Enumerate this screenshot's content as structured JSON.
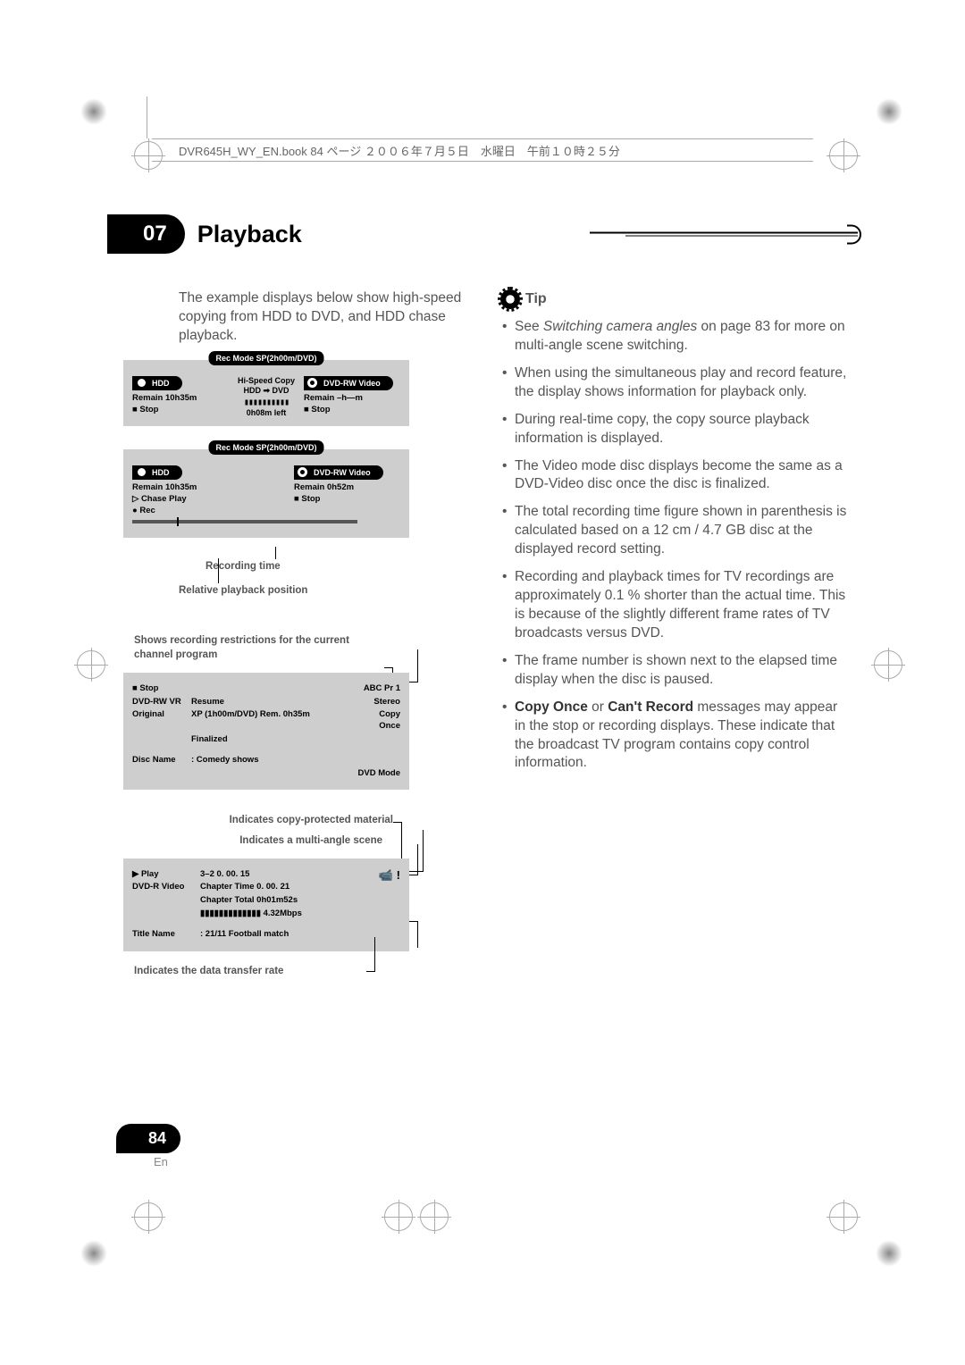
{
  "header": {
    "filename": "DVR645H_WY_EN.book  84 ページ  ２００６年７月５日　水曜日　午前１０時２５分"
  },
  "chapter": {
    "number": "07",
    "title": "Playback"
  },
  "intro": "The example displays below show high-speed copying from HDD to DVD, and HDD chase playback.",
  "dia1": {
    "recmode": "Rec Mode   SP(2h00m/DVD)",
    "left_badge": "HDD",
    "left_l1": "Remain  10h35m",
    "left_l2": "■ Stop",
    "mid_l1": "Hi-Speed Copy",
    "mid_l2": "HDD  ➡ DVD",
    "mid_hatch": "▮▮▮▮▮▮▮▮▮▮",
    "mid_l3": "0h08m left",
    "right_badge": "DVD-RW Video",
    "right_l1": "Remain  –h—m",
    "right_l2": "■ Stop"
  },
  "dia2": {
    "recmode": "Rec Mode   SP(2h00m/DVD)",
    "left_badge": "HDD",
    "left_l1": "Remain  10h35m",
    "left_l2": "▷ Chase Play",
    "left_l3": "● Rec",
    "right_badge": "DVD-RW Video",
    "right_l1": "Remain  0h52m",
    "right_l2": "■ Stop",
    "callout1": "Recording time",
    "callout2": "Relative playback position"
  },
  "dia3": {
    "caption": "Shows recording restrictions for the current channel program",
    "r1c1": "■ Stop",
    "r1c3": "ABC  Pr 1",
    "r2c1": "DVD-RW  VR",
    "r2c2": "Resume",
    "r2c3": "Stereo",
    "r3c1": "Original",
    "r3c2": "XP (1h00m/DVD)          Rem.     0h35m",
    "r3c3": "Copy Once",
    "r4c2": "Finalized",
    "r5c1": "Disc Name",
    "r5c2": ":  Comedy shows",
    "r6c3": "DVD Mode"
  },
  "dia4": {
    "caption1": "Indicates copy-protected material",
    "caption2": "Indicates a multi-angle scene",
    "r1c1": "▶ Play",
    "r1c2": "3–2          0. 00. 15",
    "r2c1": "DVD-R  Video",
    "r2c2": "Chapter Time     0. 00. 21",
    "r3c2": "Chapter Total     0h01m52s",
    "r4c2": "▮▮▮▮▮▮▮▮▮▮▮▮▮                  4.32Mbps",
    "r5c1": "Title Name",
    "r5c2": ":   21/11 Football match",
    "caption3": "Indicates the data transfer rate",
    "cam": "📹  !"
  },
  "tip": {
    "head": "Tip",
    "items": [
      "See <em>Switching camera angles</em> on page 83 for more on multi-angle scene switching.",
      "When using the simultaneous play and record feature, the display shows information for playback only.",
      "During real-time copy, the copy source playback information is displayed.",
      "The Video mode disc displays become the same as a DVD-Video disc once the disc is finalized.",
      "The total recording time figure shown in parenthesis is calculated based on a 12 cm / 4.7 GB disc at the displayed record setting.",
      "Recording and playback times for TV recordings are approximately 0.1 % shorter than the actual time. This is because of the slightly different frame rates of TV broadcasts versus DVD.",
      "The frame number is shown next to the elapsed time display when the disc is paused.",
      "<b>Copy Once</b> or <b>Can't Record</b> messages may appear in the stop or recording displays. These indicate that the broadcast TV program contains copy control information."
    ]
  },
  "footer": {
    "page": "84",
    "lang": "En"
  }
}
